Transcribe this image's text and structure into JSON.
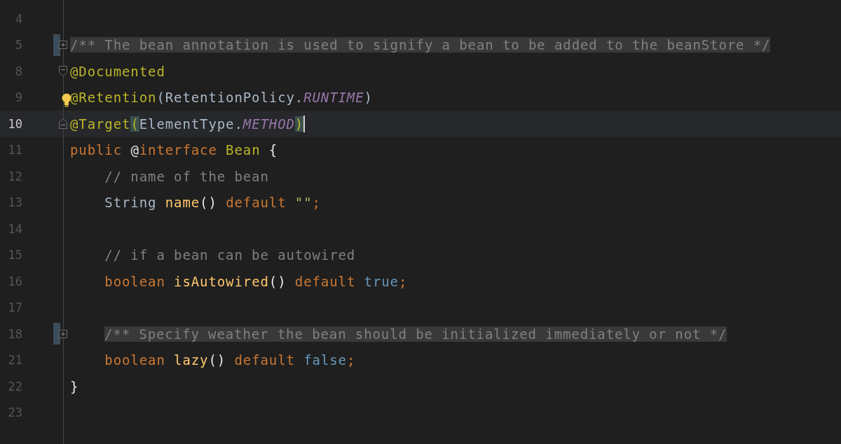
{
  "editor": {
    "lines": [
      {
        "number": "4",
        "current": false
      },
      {
        "number": "5",
        "current": false,
        "folded": true,
        "tokens": [
          {
            "text": "/** The bean annotation is used to signify a bean to be added to the beanStore */",
            "kind": "comment"
          }
        ]
      },
      {
        "number": "8",
        "current": false,
        "fold_start": true,
        "tokens": [
          {
            "text": "@Documented",
            "kind": "annotation"
          }
        ]
      },
      {
        "number": "9",
        "current": false,
        "intention": true,
        "tokens": [
          {
            "text": "@Retention",
            "kind": "annotation"
          },
          {
            "text": "(RetentionPolicy.",
            "kind": "plain"
          },
          {
            "text": "RUNTIME",
            "kind": "constant"
          },
          {
            "text": ")",
            "kind": "plain"
          }
        ]
      },
      {
        "number": "10",
        "current": true,
        "fold_end": true,
        "caret": true,
        "tokens": [
          {
            "text": "@Target",
            "kind": "annotation",
            "matched": false
          },
          {
            "text": "(",
            "kind": "annotation",
            "matched": true
          },
          {
            "text": "ElementType.",
            "kind": "plain",
            "matched": false
          },
          {
            "text": "METHOD",
            "kind": "constant",
            "matched": false
          },
          {
            "text": ")",
            "kind": "annotation",
            "matched": true
          }
        ]
      },
      {
        "number": "11",
        "current": false,
        "tokens": [
          {
            "text": "public ",
            "kind": "keyword"
          },
          {
            "text": "@",
            "kind": "brace"
          },
          {
            "text": "interface ",
            "kind": "keyword"
          },
          {
            "text": "Bean",
            "kind": "annotation"
          },
          {
            "text": " {",
            "kind": "brace"
          }
        ]
      },
      {
        "number": "12",
        "current": false,
        "tokens": [
          {
            "text": "    // name of the bean",
            "kind": "comment"
          }
        ]
      },
      {
        "number": "13",
        "current": false,
        "tokens": [
          {
            "text": "    String ",
            "kind": "plain"
          },
          {
            "text": "name",
            "kind": "method"
          },
          {
            "text": "() ",
            "kind": "brace"
          },
          {
            "text": "default ",
            "kind": "keyword"
          },
          {
            "text": "\"\"",
            "kind": "string"
          },
          {
            "text": ";",
            "kind": "keyword"
          }
        ]
      },
      {
        "number": "14",
        "current": false
      },
      {
        "number": "15",
        "current": false,
        "tokens": [
          {
            "text": "    // if a bean can be autowired",
            "kind": "comment"
          }
        ]
      },
      {
        "number": "16",
        "current": false,
        "tokens": [
          {
            "text": "    boolean ",
            "kind": "keyword"
          },
          {
            "text": "isAutowired",
            "kind": "method"
          },
          {
            "text": "() ",
            "kind": "brace"
          },
          {
            "text": "default ",
            "kind": "keyword"
          },
          {
            "text": "true",
            "kind": "number"
          },
          {
            "text": ";",
            "kind": "keyword"
          }
        ]
      },
      {
        "number": "17",
        "current": false
      },
      {
        "number": "18",
        "current": false,
        "folded": true,
        "indented": true,
        "tokens": [
          {
            "text": "/** Specify weather the bean should be initialized immediately or not */",
            "kind": "comment"
          }
        ]
      },
      {
        "number": "21",
        "current": false,
        "tokens": [
          {
            "text": "    boolean ",
            "kind": "keyword"
          },
          {
            "text": "lazy",
            "kind": "method"
          },
          {
            "text": "() ",
            "kind": "brace"
          },
          {
            "text": "default ",
            "kind": "keyword"
          },
          {
            "text": "false",
            "kind": "number"
          },
          {
            "text": ";",
            "kind": "keyword"
          }
        ]
      },
      {
        "number": "22",
        "current": false,
        "tokens": [
          {
            "text": "}",
            "kind": "brace"
          }
        ]
      },
      {
        "number": "23",
        "current": false
      }
    ]
  }
}
